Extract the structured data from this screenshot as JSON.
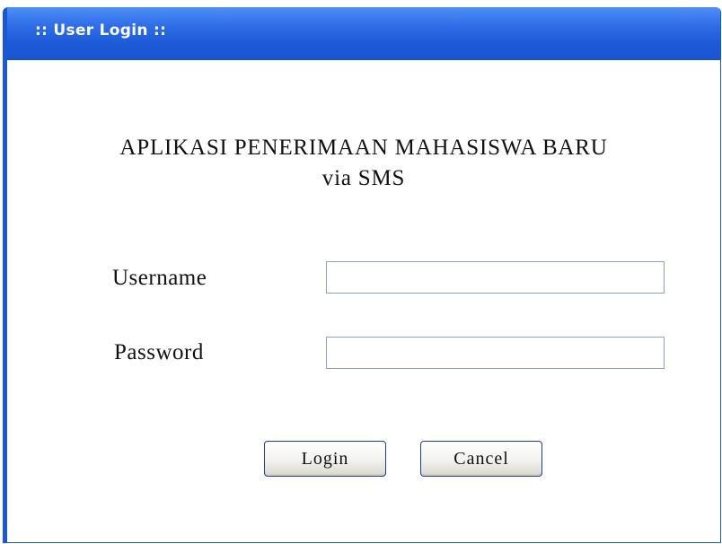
{
  "window": {
    "title": ":: User Login ::"
  },
  "heading": {
    "line1": "APLIKASI PENERIMAAN MAHASISWA BARU",
    "line2": "via SMS"
  },
  "form": {
    "username_label": "Username",
    "username_value": "",
    "password_label": "Password",
    "password_value": ""
  },
  "buttons": {
    "login_label": "Login",
    "cancel_label": "Cancel"
  },
  "colors": {
    "titlebar": "#2f6ee6",
    "title_text": "#ffffff",
    "border": "#1a57d4"
  }
}
